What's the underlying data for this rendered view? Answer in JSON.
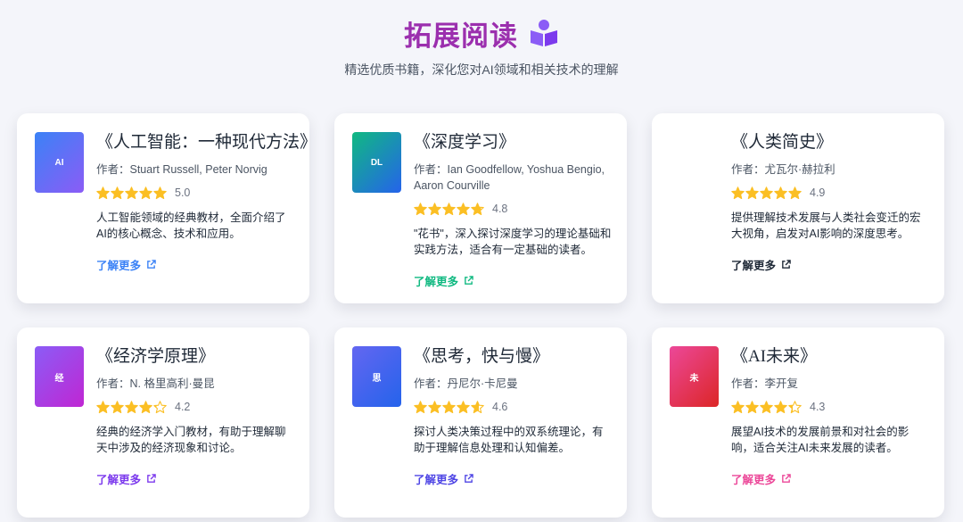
{
  "header": {
    "title": "拓展阅读",
    "subtitle": "精选优质书籍，深化您对AI领域和相关技术的理解"
  },
  "books": [
    {
      "cover": "AI",
      "cover_colors": [
        "#3b82f6",
        "#8b5cf6"
      ],
      "title": "《人工智能：一种现代方法》",
      "author": "作者：Stuart Russell, Peter Norvig",
      "rating": 5.0,
      "rating_text": "5.0",
      "description": "人工智能领域的经典教材，全面介绍了AI的核心概念、技术和应用。",
      "link_label": "了解更多",
      "link_color": "#3b82f6"
    },
    {
      "cover": "DL",
      "cover_colors": [
        "#10b981",
        "#2563eb"
      ],
      "title": "《深度学习》",
      "author": "作者：Ian Goodfellow, Yoshua Bengio, Aaron Courville",
      "rating": 4.8,
      "rating_text": "4.8",
      "description": "\"花书\"，深入探讨深度学习的理论基础和实践方法，适合有一定基础的读者。",
      "link_label": "了解更多",
      "link_color": "#10b981"
    },
    {
      "cover": "",
      "cover_colors": [],
      "title": "《人类简史》",
      "author": "作者：尤瓦尔·赫拉利",
      "rating": 4.9,
      "rating_text": "4.9",
      "description": "提供理解技术发展与人类社会变迁的宏大视角，启发对AI影响的深度思考。",
      "link_label": "了解更多",
      "link_color": "#1f2937"
    },
    {
      "cover": "经",
      "cover_colors": [
        "#8b5cf6",
        "#c026d3"
      ],
      "title": "《经济学原理》",
      "author": "作者：N. 格里高利·曼昆",
      "rating": 4.2,
      "rating_text": "4.2",
      "description": "经典的经济学入门教材，有助于理解聊天中涉及的经济现象和讨论。",
      "link_label": "了解更多",
      "link_color": "#7c3aed"
    },
    {
      "cover": "思",
      "cover_colors": [
        "#6366f1",
        "#2563eb"
      ],
      "title": "《思考，快与慢》",
      "author": "作者：丹尼尔·卡尼曼",
      "rating": 4.6,
      "rating_text": "4.6",
      "description": "探讨人类决策过程中的双系统理论，有助于理解信息处理和认知偏差。",
      "link_label": "了解更多",
      "link_color": "#4f46e5"
    },
    {
      "cover": "未",
      "cover_colors": [
        "#ec4899",
        "#dc2626"
      ],
      "title": "《AI未来》",
      "author": "作者：李开复",
      "rating": 4.3,
      "rating_text": "4.3",
      "description": "展望AI技术的发展前景和对社会的影响，适合关注AI未来发展的读者。",
      "link_label": "了解更多",
      "link_color": "#ec4899"
    }
  ],
  "colors": {
    "title": "#9b2fae",
    "star": "#fbbf24",
    "star_empty": "#d1d5db",
    "book_icon": "#8b5cf6"
  }
}
